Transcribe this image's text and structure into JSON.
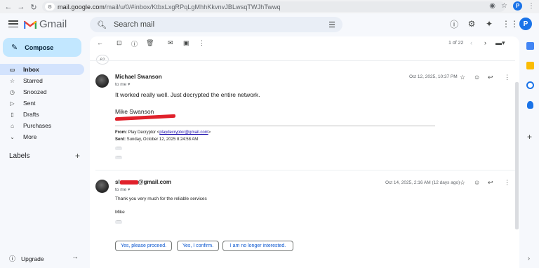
{
  "browser": {
    "url_host": "mail.google.com",
    "url_path": "/mail/u/0/#inbox/KtbxLxgRPqLgMhhKkvnvJBLwsqTWJhTwwq",
    "avatar_letter": "P"
  },
  "app": {
    "logo_text": "Gmail",
    "search_placeholder": "Search mail",
    "avatar_letter": "P"
  },
  "sidebar": {
    "compose_label": "Compose",
    "items": [
      {
        "label": "Inbox",
        "icon": "inbox-icon",
        "active": true
      },
      {
        "label": "Starred",
        "icon": "star-icon",
        "active": false
      },
      {
        "label": "Snoozed",
        "icon": "clock-icon",
        "active": false
      },
      {
        "label": "Sent",
        "icon": "send-icon",
        "active": false
      },
      {
        "label": "Drafts",
        "icon": "draft-icon",
        "active": false
      },
      {
        "label": "Purchases",
        "icon": "bag-icon",
        "active": false
      },
      {
        "label": "More",
        "icon": "chevron-down-icon",
        "active": false
      }
    ],
    "labels_title": "Labels",
    "upgrade_label": "Upgrade"
  },
  "toolbar": {
    "pagination": "1 of 22"
  },
  "thread": {
    "collapsed_count": "62",
    "messages": [
      {
        "sender": "Michael Swanson",
        "to": "to me",
        "date": "Oct 12, 2025, 10:37 PM",
        "body": "It worked really well. Just decrypted the entire network.",
        "signature": "Mike Swanson",
        "quote_from_label": "From:",
        "quote_from_value": "Play Decryptor <",
        "quote_from_email": "playdecryptor@gmail.com",
        "quote_from_end": ">",
        "quote_sent_label": "Sent:",
        "quote_sent_value": "Sunday, October 12, 2025 8:24:58 AM"
      },
      {
        "sender_prefix": "sl",
        "sender_suffix": "@gmail.com",
        "to": "to me",
        "date": "Oct 14, 2025, 2:16 AM (12 days ago)",
        "body": "Thank you very much for the reliable services",
        "signature": "Mike"
      }
    ],
    "smart_replies": [
      "Yes, please proceed.",
      "Yes, I confirm.",
      "I am no longer interested."
    ]
  },
  "colors": {
    "accent": "#0b57d0",
    "compose_bg": "#c2e7ff",
    "active_nav": "#d3e3fd",
    "redaction": "#e0202a"
  }
}
